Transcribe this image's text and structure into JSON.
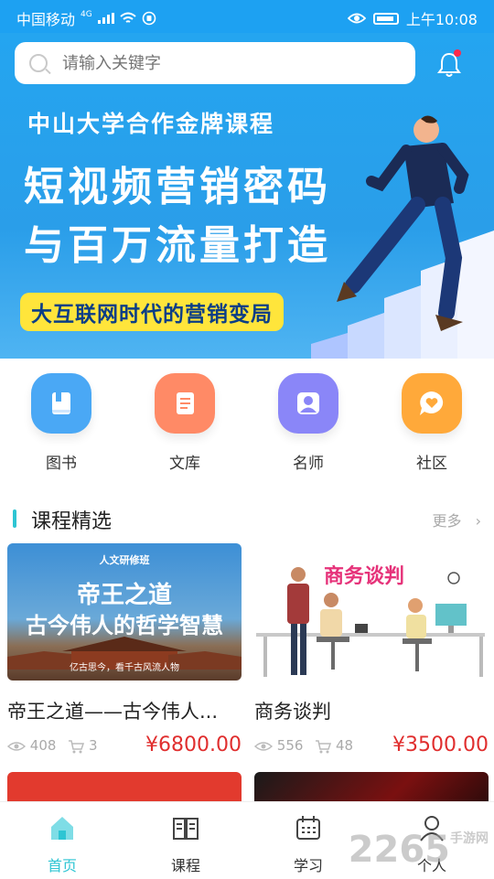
{
  "status_bar": {
    "carrier": "中国移动",
    "network": "4G",
    "time": "上午10:08"
  },
  "search": {
    "placeholder": "请输入关键字"
  },
  "banner": {
    "subtitle": "中山大学合作金牌课程",
    "title_line1": "短视频营销密码",
    "title_line2": "与百万流量打造",
    "tag": "大互联网时代的营销变局"
  },
  "categories": [
    {
      "label": "图书",
      "icon": "book-icon",
      "color": "#4aa8f5"
    },
    {
      "label": "文库",
      "icon": "document-icon",
      "color": "#ff8a66"
    },
    {
      "label": "名师",
      "icon": "teacher-icon",
      "color": "#8a86f8"
    },
    {
      "label": "社区",
      "icon": "community-icon",
      "color": "#ffa93a"
    }
  ],
  "section": {
    "title": "课程精选",
    "more": "更多"
  },
  "courses": [
    {
      "name": "帝王之道——古今伟人...",
      "views": "408",
      "cart": "3",
      "price": "¥6800.00",
      "image": {
        "badge": "人文研修班",
        "line1": "帝王之道",
        "line2": "古今伟人的哲学智慧",
        "caption": "亿古思今，看千古风流人物"
      }
    },
    {
      "name": "商务谈判",
      "views": "556",
      "cart": "48",
      "price": "¥3500.00",
      "image": {
        "title": "商务谈判"
      }
    }
  ],
  "nav": [
    {
      "label": "首页",
      "icon": "home-icon",
      "active": true
    },
    {
      "label": "课程",
      "icon": "course-book-icon",
      "active": false
    },
    {
      "label": "学习",
      "icon": "calendar-icon",
      "active": false
    },
    {
      "label": "个人",
      "icon": "person-icon",
      "active": false
    }
  ],
  "watermark": {
    "text": "2265",
    "sub": "手游网"
  },
  "colors": {
    "primary": "#24a5f0",
    "accent": "#2ec5d3",
    "price": "#e02e2e"
  }
}
